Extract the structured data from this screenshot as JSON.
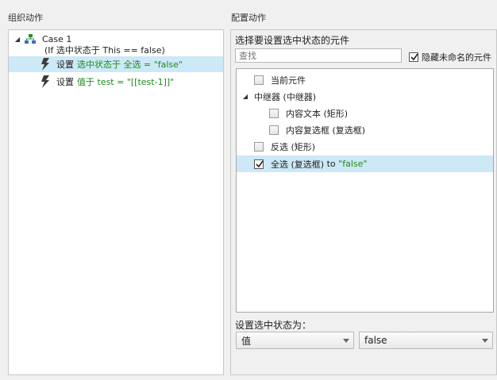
{
  "left": {
    "title": "组织动作",
    "case": {
      "label": "Case 1",
      "condition": "(If 选中状态于 This == false)"
    },
    "actions": [
      {
        "prefix": "设置",
        "detail": "选中状态于 全选 = \"false\""
      },
      {
        "prefix": "设置",
        "detail": "值于 test = \"[[test-1]]\""
      }
    ]
  },
  "right": {
    "title": "配置动作",
    "select_label": "选择要设置选中状态的元件",
    "search_placeholder": "查找",
    "hide_unnamed_label": "隐藏未命名的元件",
    "elements": {
      "current": "当前元件",
      "repeater": "中继器 (中继器)",
      "content_text": "内容文本 (矩形)",
      "content_checkbox": "内容复选框 (复选框)",
      "invert": "反选 (矩形)",
      "select_all_name": "全选 (复选框)",
      "select_all_to": " to ",
      "select_all_value": "\"false\""
    },
    "set_state_label": "设置选中状态为：",
    "type_dropdown": "值",
    "value_dropdown": "false"
  },
  "colors": {
    "selection": "#cde8f6",
    "green_text": "#1e8c1e"
  }
}
